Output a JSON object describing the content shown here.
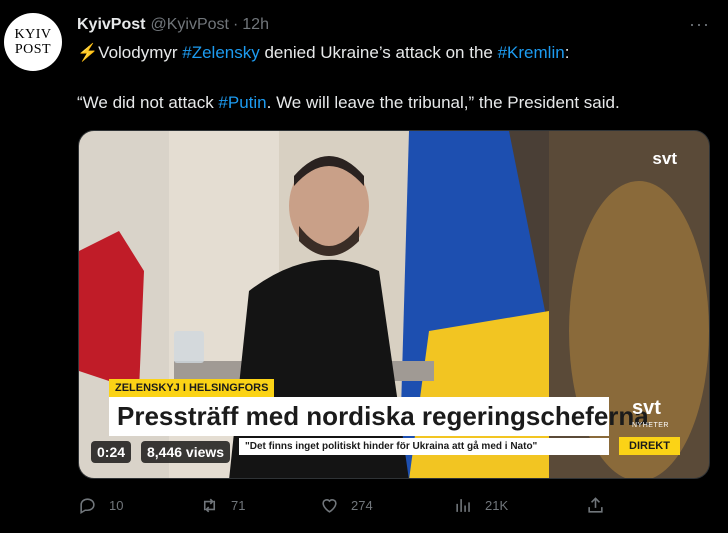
{
  "account": {
    "avatar_line1": "KYIV",
    "avatar_line2": "POST",
    "name": "KyivPost",
    "handle": "@KyivPost",
    "separator": "·",
    "time": "12h"
  },
  "more_label": "···",
  "tweet": {
    "bolt": "⚡",
    "part1": "Volodymyr ",
    "tag1": "#Zelensky",
    "part2": " denied Ukraine’s attack on the ",
    "tag2": "#Kremlin",
    "part3": ":",
    "part4": "“We did not attack ",
    "tag3": "#Putin",
    "part5": ". We will leave the tribunal,” the President said."
  },
  "video": {
    "svt_top": "svt",
    "lower_tag": "ZELENSKYJ I HELSINGFORS",
    "lower_title": "Pressträff med nordiska regeringscheferna",
    "lower_sub": "\"Det finns inget politiskt hinder för Ukraina att gå med i Nato\"",
    "svt_bottom": "svt",
    "svt_bottom_sub": "NYHETER",
    "direkt": "DIREKT",
    "timer": "0:24",
    "views": "8,446 views"
  },
  "actions": {
    "replies": "10",
    "retweets": "71",
    "likes": "274",
    "views": "21K"
  },
  "colors": {
    "accent": "#1d9bf0",
    "muted": "#71767b",
    "ukraine_blue": "#1d4fb0",
    "ukraine_yellow": "#f2c522"
  }
}
